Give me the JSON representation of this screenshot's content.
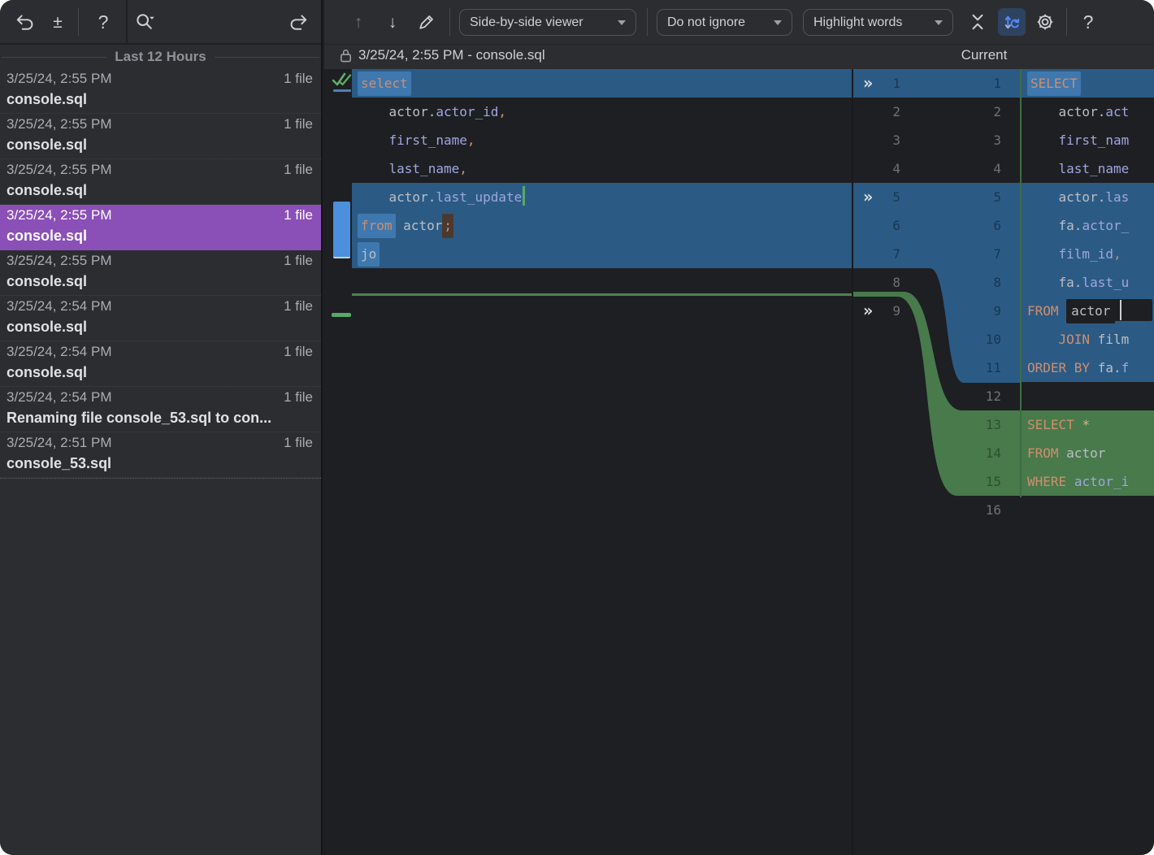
{
  "sidebar": {
    "group_label": "Last 12 Hours",
    "entries": [
      {
        "time": "3/25/24, 2:55 PM",
        "files": "1 file",
        "name": "console.sql",
        "selected": false
      },
      {
        "time": "3/25/24, 2:55 PM",
        "files": "1 file",
        "name": "console.sql",
        "selected": false
      },
      {
        "time": "3/25/24, 2:55 PM",
        "files": "1 file",
        "name": "console.sql",
        "selected": false
      },
      {
        "time": "3/25/24, 2:55 PM",
        "files": "1 file",
        "name": "console.sql",
        "selected": true
      },
      {
        "time": "3/25/24, 2:55 PM",
        "files": "1 file",
        "name": "console.sql",
        "selected": false
      },
      {
        "time": "3/25/24, 2:54 PM",
        "files": "1 file",
        "name": "console.sql",
        "selected": false
      },
      {
        "time": "3/25/24, 2:54 PM",
        "files": "1 file",
        "name": "console.sql",
        "selected": false
      },
      {
        "time": "3/25/24, 2:54 PM",
        "files": "1 file",
        "name": "Renaming file console_53.sql to con...",
        "selected": false
      },
      {
        "time": "3/25/24, 2:51 PM",
        "files": "1 file",
        "name": "console_53.sql",
        "selected": false
      }
    ],
    "icons": [
      "undo-icon",
      "plus-minus-diff-icon",
      "help-icon",
      "search-icon",
      "revert-icon"
    ]
  },
  "toolbar": {
    "viewer_dropdown": "Side-by-side viewer",
    "ignore_dropdown": "Do not ignore",
    "highlight_dropdown": "Highlight words",
    "icons": [
      "previous-change-icon",
      "next-change-icon",
      "edit-icon",
      "collapse-unchanged-icon",
      "sync-scroll-icon",
      "settings-icon",
      "help-icon"
    ]
  },
  "diff": {
    "left_title": "3/25/24, 2:55 PM - console.sql",
    "right_title": "Current",
    "left_lines": [
      {
        "num": 1,
        "state": "changed",
        "tokens": [
          {
            "t": "select",
            "c": "kw",
            "hl": "word"
          }
        ]
      },
      {
        "num": 2,
        "state": "same",
        "tokens": [
          {
            "t": "    ",
            "c": "plain"
          },
          {
            "t": "actor",
            "c": "id"
          },
          {
            "t": ".",
            "c": "plain"
          },
          {
            "t": "actor_id",
            "c": "col"
          },
          {
            "t": ",",
            "c": "kw"
          }
        ]
      },
      {
        "num": 3,
        "state": "same",
        "tokens": [
          {
            "t": "    ",
            "c": "plain"
          },
          {
            "t": "first_name",
            "c": "col"
          },
          {
            "t": ",",
            "c": "kw"
          }
        ]
      },
      {
        "num": 4,
        "state": "same",
        "tokens": [
          {
            "t": "    ",
            "c": "plain"
          },
          {
            "t": "last_name",
            "c": "col"
          },
          {
            "t": ",",
            "c": "kw"
          }
        ]
      },
      {
        "num": 5,
        "state": "changed",
        "tokens": [
          {
            "t": "    ",
            "c": "plain"
          },
          {
            "t": "actor",
            "c": "id"
          },
          {
            "t": ".",
            "c": "plain"
          },
          {
            "t": "last_update",
            "c": "col"
          },
          {
            "caret": "green"
          }
        ]
      },
      {
        "num": 6,
        "state": "changed",
        "tokens": [
          {
            "t": "from",
            "c": "kw",
            "hl": "word"
          },
          {
            "t": " ",
            "c": "plain"
          },
          {
            "t": "actor",
            "c": "id"
          },
          {
            "t": ";",
            "c": "kw",
            "hl": "brown"
          }
        ]
      },
      {
        "num": 7,
        "state": "changed",
        "tokens": [
          {
            "t": "jo",
            "c": "id",
            "hl": "word"
          }
        ]
      },
      {
        "num": 8,
        "state": "same",
        "tokens": []
      }
    ],
    "right_lines": [
      {
        "num": 1,
        "state": "changed",
        "tokens": [
          {
            "t": "SELECT",
            "c": "kw",
            "hl": "word"
          }
        ]
      },
      {
        "num": 2,
        "state": "same",
        "tokens": [
          {
            "t": "    ",
            "c": "plain"
          },
          {
            "t": "actor",
            "c": "id"
          },
          {
            "t": ".",
            "c": "plain"
          },
          {
            "t": "act",
            "c": "col"
          }
        ]
      },
      {
        "num": 3,
        "state": "same",
        "tokens": [
          {
            "t": "    ",
            "c": "plain"
          },
          {
            "t": "first_nam",
            "c": "col"
          }
        ]
      },
      {
        "num": 4,
        "state": "same",
        "tokens": [
          {
            "t": "    ",
            "c": "plain"
          },
          {
            "t": "last_name",
            "c": "col"
          }
        ]
      },
      {
        "num": 5,
        "state": "changed",
        "tokens": [
          {
            "t": "    ",
            "c": "plain"
          },
          {
            "t": "actor",
            "c": "id"
          },
          {
            "t": ".",
            "c": "plain"
          },
          {
            "t": "las",
            "c": "col"
          }
        ]
      },
      {
        "num": 6,
        "state": "changed",
        "tokens": [
          {
            "t": "    ",
            "c": "plain"
          },
          {
            "t": "fa",
            "c": "id"
          },
          {
            "t": ".",
            "c": "plain"
          },
          {
            "t": "actor_",
            "c": "col"
          }
        ]
      },
      {
        "num": 7,
        "state": "changed",
        "tokens": [
          {
            "t": "    ",
            "c": "plain"
          },
          {
            "t": "film_id",
            "c": "col"
          },
          {
            "t": ",",
            "c": "kw"
          }
        ]
      },
      {
        "num": 8,
        "state": "changed",
        "tokens": [
          {
            "t": "    ",
            "c": "plain"
          },
          {
            "t": "fa",
            "c": "id"
          },
          {
            "t": ".",
            "c": "plain"
          },
          {
            "t": "last_u",
            "c": "col"
          }
        ]
      },
      {
        "num": 9,
        "state": "changed",
        "tokens": [
          {
            "t": "FROM",
            "c": "kw"
          },
          {
            "t": " ",
            "c": "plain"
          },
          {
            "t": "actor",
            "c": "id",
            "hl": "dark"
          },
          {
            "caret": "darkbox"
          }
        ]
      },
      {
        "num": 10,
        "state": "changed",
        "tokens": [
          {
            "t": "    ",
            "c": "plain"
          },
          {
            "t": "JOIN",
            "c": "kw"
          },
          {
            "t": " ",
            "c": "plain"
          },
          {
            "t": "film",
            "c": "id"
          }
        ]
      },
      {
        "num": 11,
        "state": "changed",
        "tokens": [
          {
            "t": "ORDER BY",
            "c": "kw"
          },
          {
            "t": " ",
            "c": "plain"
          },
          {
            "t": "fa",
            "c": "id"
          },
          {
            "t": ".",
            "c": "plain"
          },
          {
            "t": "f",
            "c": "col"
          }
        ]
      },
      {
        "num": 12,
        "state": "same",
        "tokens": []
      },
      {
        "num": 13,
        "state": "inserted",
        "tokens": [
          {
            "t": "SELECT",
            "c": "kw"
          },
          {
            "t": " ",
            "c": "plain"
          },
          {
            "t": "*",
            "c": "star"
          }
        ]
      },
      {
        "num": 14,
        "state": "inserted",
        "tokens": [
          {
            "t": "FROM",
            "c": "kw"
          },
          {
            "t": " ",
            "c": "plain"
          },
          {
            "t": "actor",
            "c": "id"
          }
        ]
      },
      {
        "num": 15,
        "state": "inserted",
        "tokens": [
          {
            "t": "WHERE",
            "c": "kw"
          },
          {
            "t": " ",
            "c": "plain"
          },
          {
            "t": "actor_i",
            "c": "col"
          }
        ]
      },
      {
        "num": 16,
        "state": "same",
        "tokens": []
      }
    ],
    "left_gutter": [
      {
        "n": "1",
        "state": "changed",
        "arrow": true
      },
      {
        "n": "2",
        "state": "same"
      },
      {
        "n": "3",
        "state": "same"
      },
      {
        "n": "4",
        "state": "same"
      },
      {
        "n": "5",
        "state": "changed",
        "arrow": true
      },
      {
        "n": "6",
        "state": "changed"
      },
      {
        "n": "7",
        "state": "changed"
      },
      {
        "n": "8",
        "state": "same"
      },
      {
        "n": "9",
        "state": "same",
        "arrow": true
      }
    ],
    "right_gutter": [
      {
        "n": "1",
        "state": "changed"
      },
      {
        "n": "2",
        "state": "same"
      },
      {
        "n": "3",
        "state": "same"
      },
      {
        "n": "4",
        "state": "same"
      },
      {
        "n": "5",
        "state": "changed"
      },
      {
        "n": "6",
        "state": "changed"
      },
      {
        "n": "7",
        "state": "changed"
      },
      {
        "n": "8",
        "state": "changed"
      },
      {
        "n": "9",
        "state": "changed"
      },
      {
        "n": "10",
        "state": "changed"
      },
      {
        "n": "11",
        "state": "changed"
      },
      {
        "n": "12",
        "state": "same"
      },
      {
        "n": "13",
        "state": "inserted"
      },
      {
        "n": "14",
        "state": "inserted"
      },
      {
        "n": "15",
        "state": "inserted"
      },
      {
        "n": "16",
        "state": "same"
      }
    ],
    "apply_arrow_glyph": "»"
  },
  "colors": {
    "panel_bg": "#2B2D30",
    "editor_bg": "#1E1F22",
    "changed_row": "#2B5B85",
    "changed_word": "#3E78AE",
    "inserted_row": "#487A4C",
    "inserted_line": "#4E8052",
    "selection_purple": "#8B4FB8",
    "keyword": "#CF8E6D",
    "identifier": "#BCBEC4",
    "column_ref": "#9FA6E0",
    "star": "#D5B778",
    "gutter_marker_blue": "#4B8FDD",
    "gutter_marker_green": "#59A869"
  }
}
